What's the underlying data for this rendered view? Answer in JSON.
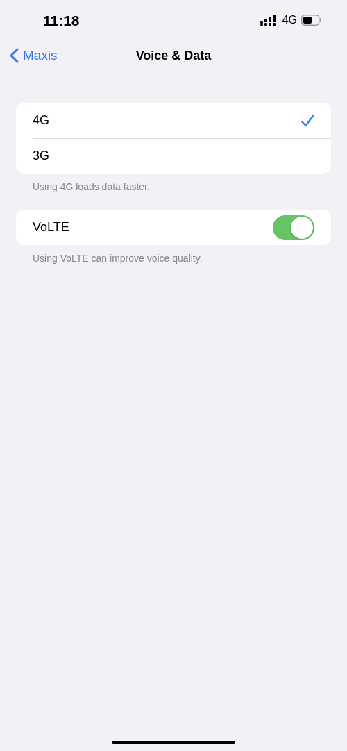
{
  "status_bar": {
    "time": "11:18",
    "network": "4G"
  },
  "nav": {
    "back": "Maxis",
    "title": "Voice & Data"
  },
  "data_options": [
    {
      "label": "4G",
      "selected": true
    },
    {
      "label": "3G",
      "selected": false
    }
  ],
  "data_footer": "Using 4G loads data faster.",
  "volte": {
    "label": "VoLTE",
    "on": true
  },
  "volte_footer": "Using VoLTE can improve voice quality."
}
